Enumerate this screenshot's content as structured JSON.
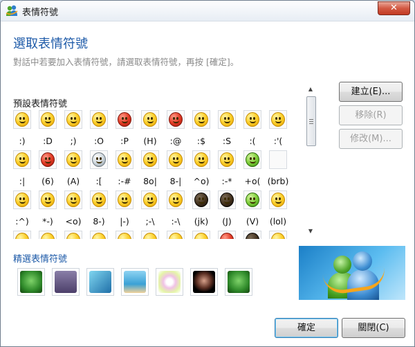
{
  "window": {
    "title": "表情符號",
    "close_label": "✕"
  },
  "header": {
    "title": "選取表情符號",
    "subtitle": "對話中若要加入表情符號，請選取表情符號，再按 [確定]。"
  },
  "default_emoticons": {
    "label": "預設表情符號",
    "rows": [
      [
        "",
        ":)",
        ":D",
        ";)",
        ":O",
        ":P",
        "(H)",
        ":@",
        ":$",
        ":S",
        ":(",
        ":'("
      ],
      [
        ":|",
        "(6)",
        "(A)",
        ":[",
        ":-#",
        "8o|",
        "8-|",
        "^o)",
        ":-*",
        "+o(",
        "(brb)"
      ],
      [
        ":^)",
        "*-)",
        "<o)",
        "8-)",
        "|-)",
        ";-\\",
        ":-\\",
        "(jk)",
        "(J)",
        "(V)",
        "(lol)"
      ]
    ]
  },
  "buttons": {
    "create": "建立(E)...",
    "remove": "移除(R)",
    "edit": "修改(M)...",
    "ok": "確定",
    "close": "關閉(C)"
  },
  "featured": {
    "label": "精選表情符號",
    "items": [
      "green-monster-icon",
      "purple-cats-icon",
      "ocean-wave-icon",
      "palm-island-icon",
      "flowers-icon",
      "dancer-icon",
      "green-monster-2-icon"
    ]
  },
  "colors": {
    "accent": "#1d5aa8",
    "close": "#c23a22"
  }
}
